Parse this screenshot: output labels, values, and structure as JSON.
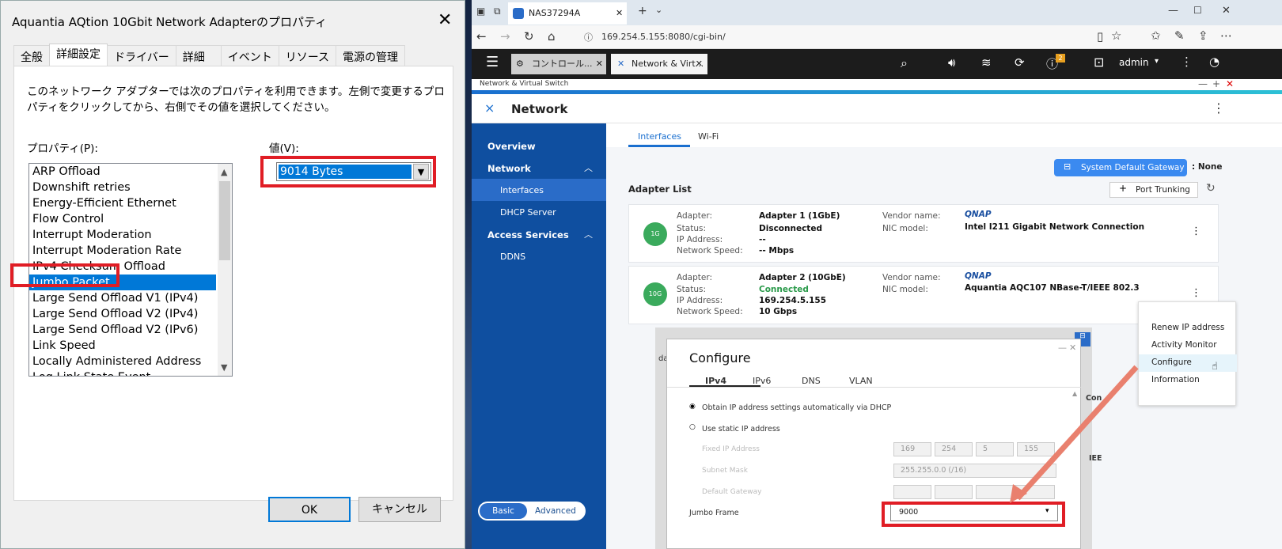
{
  "left": {
    "title": "Aquantia AQtion 10Gbit Network Adapterのプロパティ",
    "tabs": [
      "全般",
      "詳細設定",
      "ドライバー",
      "詳細",
      "イベント",
      "リソース",
      "電源の管理"
    ],
    "description": "このネットワーク アダプターでは次のプロパティを利用できます。左側で変更するプロパティをクリックしてから、右側でその値を選択してください。",
    "property_label": "プロパティ(P):",
    "value_label": "値(V):",
    "properties": [
      "ARP Offload",
      "Downshift retries",
      "Energy-Efficient Ethernet",
      "Flow Control",
      "Interrupt Moderation",
      "Interrupt Moderation Rate",
      "IPv4 Checksum Offload",
      "Jumbo Packet",
      "Large Send Offload V1 (IPv4)",
      "Large Send Offload V2 (IPv4)",
      "Large Send Offload V2 (IPv6)",
      "Link Speed",
      "Locally Administered Address",
      "Log Link State Event"
    ],
    "selected_property": "Jumbo Packet",
    "value": "9014 Bytes",
    "ok": "OK",
    "cancel": "キャンセル"
  },
  "browser": {
    "tab_title": "NAS37294A",
    "url": "169.254.5.155:8080/cgi-bin/",
    "app_tabs": [
      "コントロール...",
      "Network & Virt..."
    ],
    "user": "admin",
    "notif_count": "2",
    "app_bar": "Network & Virtual Switch",
    "header": "Network",
    "nav": {
      "overview": "Overview",
      "network": "Network",
      "interfaces": "Interfaces",
      "dhcp": "DHCP Server",
      "access": "Access Services",
      "ddns": "DDNS"
    },
    "tabs": {
      "interfaces": "Interfaces",
      "wifi": "Wi-Fi"
    },
    "gateway_btn": "System Default Gateway",
    "gateway_val": ": None",
    "adapter_list": "Adapter List",
    "port_trunking": "Port Trunking",
    "keys": {
      "adapter": "Adapter:",
      "status": "Status:",
      "ip": "IP Address:",
      "speed": "Network Speed:",
      "vendor": "Vendor name:",
      "nic": "NIC model:"
    },
    "a1": {
      "badge": "1G",
      "adapter": "Adapter 1 (1GbE)",
      "status": "Disconnected",
      "ip": "--",
      "speed": "-- Mbps",
      "vendor": "QNAP",
      "nic": "Intel I211 Gigabit Network Connection"
    },
    "a2": {
      "badge": "10G",
      "adapter": "Adapter 2 (10GbE)",
      "status": "Connected",
      "ip": "169.254.5.155",
      "speed": "10 Gbps",
      "vendor": "QNAP",
      "nic": "Aquantia AQC107 NBase-T/IEEE 802.3"
    },
    "menu": [
      "Renew IP address",
      "Activity Monitor",
      "Configure",
      "Information"
    ],
    "mode_basic": "Basic",
    "mode_adv": "Advanced",
    "configure": {
      "title": "Configure",
      "tabs": [
        "IPv4",
        "IPv6",
        "DNS",
        "VLAN"
      ],
      "dhcp": "Obtain IP address settings automatically via DHCP",
      "static": "Use static IP address",
      "fixed_ip": "Fixed IP Address",
      "subnet": "Subnet Mask",
      "gateway": "Default Gateway",
      "ip_parts": [
        "169",
        "254",
        "5",
        "155"
      ],
      "subnet_val": "255.255.0.0 (/16)",
      "jumbo_label": "Jumbo Frame",
      "jumbo_val": "9000"
    }
  }
}
